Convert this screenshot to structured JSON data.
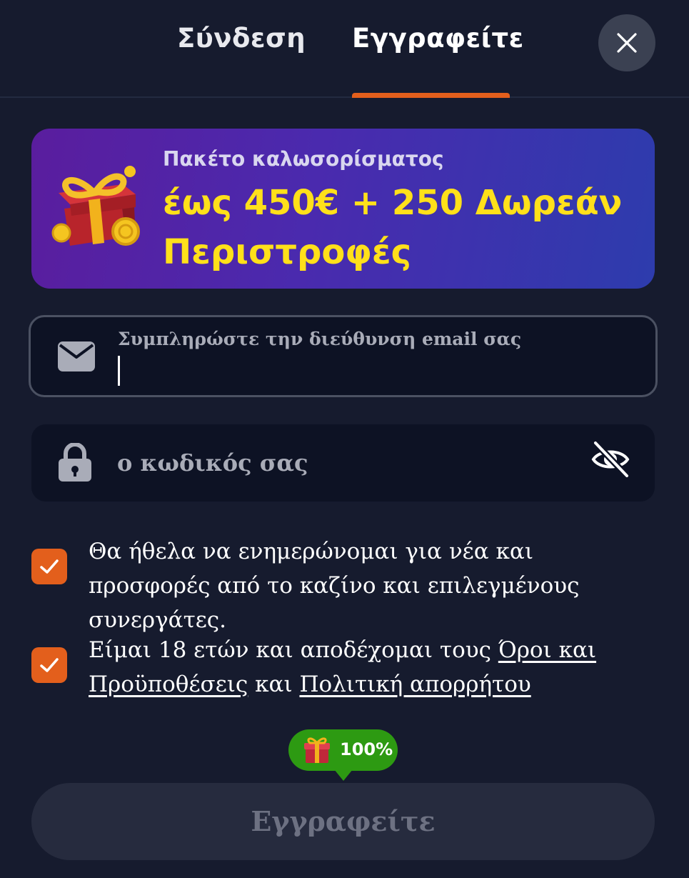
{
  "tabs": {
    "login_label": "Σύνδεση",
    "register_label": "Εγγραφείτε"
  },
  "promo": {
    "subtitle": "Πακέτο καλωσορίσματος",
    "title": "έως 450€ + 250 Δωρεάν Περιστροφές"
  },
  "form": {
    "email_label": "Συμπληρώστε την διεύθυνση email σας",
    "email_value": "",
    "password_placeholder": "ο κωδικός σας",
    "password_value": ""
  },
  "consents": {
    "newsletter": {
      "checked": true,
      "text": "Θα ήθελα να ενημερώνομαι για νέα και προσφορές από το καζίνο και επιλεγμένους συνεργάτες."
    },
    "terms": {
      "checked": true,
      "text_before": "Είμαι 18 ετών και αποδέχομαι τους ",
      "terms_link": "Όροι και Προϋποθέσεις",
      "text_middle": " και ",
      "privacy_link": "Πολιτική απορρήτου"
    }
  },
  "progress_badge": {
    "label": "100%",
    "value_percent": 100
  },
  "submit": {
    "label": "Εγγραφείτε"
  },
  "colors": {
    "background": "#161b2e",
    "accent_orange": "#e35f1c",
    "promo_yellow": "#ffe01a",
    "badge_green": "#2d9a12"
  },
  "icons": {
    "close": "close-icon",
    "gift": "gift-icon",
    "email": "envelope-icon",
    "password": "lock-icon",
    "toggle_visibility": "eye-slash-icon",
    "check": "checkmark-icon"
  }
}
